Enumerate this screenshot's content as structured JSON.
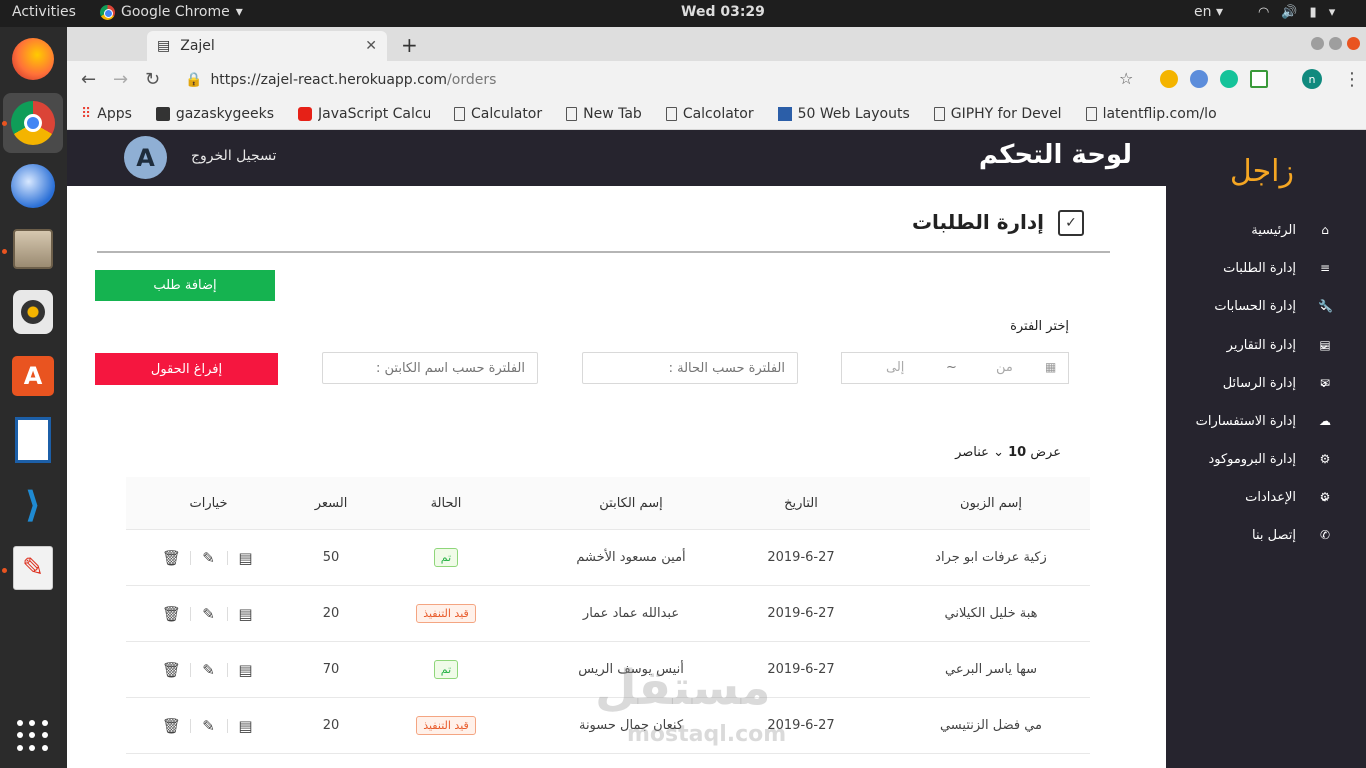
{
  "os": {
    "activities": "Activities",
    "app_name": "Google Chrome",
    "clock": "Wed 03:29",
    "lang": "en"
  },
  "browser": {
    "tab_title": "Zajel",
    "url_host": "https://zajel-react.herokuapp.com",
    "url_path": "/orders",
    "profile_initial": "n",
    "bookmarks": [
      "Apps",
      "gazaskygeeks",
      "JavaScript Calcu",
      "Calculator",
      "New Tab",
      "Calcolator",
      "50 Web Layouts",
      "GIPHY for Devel",
      "latentflip.com/lo"
    ]
  },
  "header": {
    "avatar_letter": "A",
    "logout": "تسجيل الخروج",
    "title": "لوحة التحكم"
  },
  "sidebar": {
    "brand": "زاجل",
    "items": [
      {
        "label": "الرئيسية",
        "has_submenu": false,
        "icon": "home-icon"
      },
      {
        "label": "إدارة الطلبات",
        "has_submenu": false,
        "icon": "list-icon"
      },
      {
        "label": "إدارة الحسابات",
        "has_submenu": true,
        "icon": "wrench-icon"
      },
      {
        "label": "إدارة التقارير",
        "has_submenu": true,
        "icon": "report-icon"
      },
      {
        "label": "إدارة الرسائل",
        "has_submenu": true,
        "icon": "mail-icon"
      },
      {
        "label": "إدارة الاستفسارات",
        "has_submenu": false,
        "icon": "chat-icon"
      },
      {
        "label": "إدارة البروموكود",
        "has_submenu": false,
        "icon": "gear-icon"
      },
      {
        "label": "الإعدادات",
        "has_submenu": true,
        "icon": "gear-icon"
      },
      {
        "label": "إتصل بنا",
        "has_submenu": false,
        "icon": "phone-icon"
      }
    ]
  },
  "page": {
    "section_title": "إدارة الطلبات",
    "add_button": "إضافة طلب",
    "period_label": "إختر الفترة",
    "date_from_placeholder": "من",
    "date_sep": "~",
    "date_to_placeholder": "إلى",
    "status_filter_placeholder": "الفلترة حسب الحالة :",
    "captain_filter_placeholder": "الفلترة حسب اسم الكابتن :",
    "clear_button": "إفراغ الحقول",
    "show_prefix": "عرض",
    "show_count": "10",
    "show_suffix": "عناصر"
  },
  "table": {
    "headers": {
      "customer": "إسم الزبون",
      "date": "التاريخ",
      "captain": "إسم الكابتن",
      "status": "الحالة",
      "price": "السعر",
      "options": "خيارات"
    },
    "rows": [
      {
        "customer": "زكية عرفات ابو جراد",
        "date": "2019-6-27",
        "captain": "أمين مسعود الأخشم",
        "status": "تم",
        "status_type": "done",
        "price": "50"
      },
      {
        "customer": "هبة خليل الكيلاني",
        "date": "2019-6-27",
        "captain": "عبدالله عماد عمار",
        "status": "قيد التنفيذ",
        "status_type": "prog",
        "price": "20"
      },
      {
        "customer": "سها ياسر البرعي",
        "date": "2019-6-27",
        "captain": "أنيس يوسف الريس",
        "status": "تم",
        "status_type": "done",
        "price": "70"
      },
      {
        "customer": "مي فضل الزنتيسي",
        "date": "2019-6-27",
        "captain": "كنعان جمال حسونة",
        "status": "قيد التنفيذ",
        "status_type": "prog",
        "price": "20"
      }
    ]
  },
  "watermark": {
    "main": "مستقل",
    "sub": "mostaql.com"
  },
  "colors": {
    "brand": "#f5a623",
    "add": "#15b350",
    "clear": "#f5163f",
    "dark": "#26242e"
  }
}
